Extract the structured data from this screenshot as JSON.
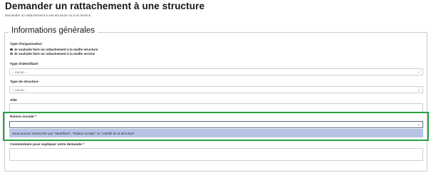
{
  "header": {
    "title": "Demander un rattachement à une structure",
    "subtitle": "Demander un rattachement à une structure ou à un service"
  },
  "form": {
    "legend": "Informations générales",
    "type_organisation": {
      "label": "Type d'organisation",
      "options": [
        {
          "label": "Je souhaite faire un rattachement à la maille structure",
          "selected": true
        },
        {
          "label": "Je souhaite faire un rattachement à la maille service",
          "selected": false
        }
      ]
    },
    "type_identifiant": {
      "label": "Type d'identifiant",
      "value": "-- Aucun --"
    },
    "type_structure": {
      "label": "Type de structure",
      "value": "-- Aucun --"
    },
    "ville": {
      "label": "Ville",
      "value": ""
    },
    "raison_sociale": {
      "label": "Raison sociale",
      "required_mark": "*",
      "value": "",
      "hint": "Vous pouvez rechercher par \"Identifiant\", \"Raison sociale\" ou \"Libellé de la structure\""
    },
    "commentaire": {
      "label": "Commentaire pour expliquer votre demande",
      "required_mark": "*",
      "value": ""
    }
  },
  "colors": {
    "highlight": "#27a243",
    "hint_background": "#b7c4e6"
  },
  "icons": {
    "select_chevron": "chevron-down-icon"
  }
}
